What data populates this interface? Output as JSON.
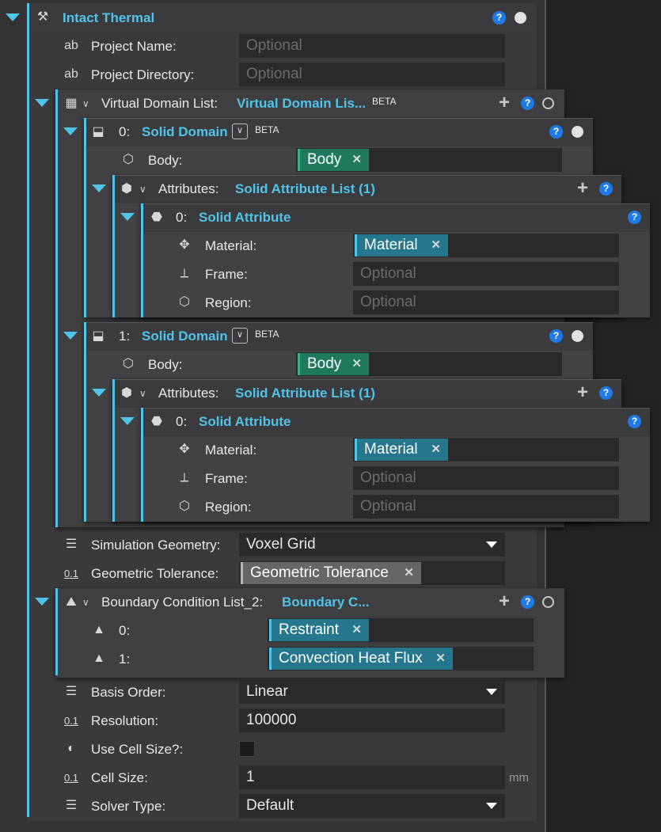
{
  "root": {
    "title": "Intact Thermal"
  },
  "project": {
    "name_label": "Project Name:",
    "name_placeholder": "Optional",
    "dir_label": "Project Directory:",
    "dir_placeholder": "Optional"
  },
  "vdl": {
    "label": "Virtual Domain List:",
    "value": "Virtual Domain Lis...",
    "badge": "BETA",
    "domains": [
      {
        "index": "0:",
        "name": "Solid Domain",
        "badge": "BETA",
        "body_label": "Body:",
        "body_value": "Body",
        "attr_label": "Attributes:",
        "attr_value": "Solid Attribute List (1)",
        "attribute": {
          "index": "0:",
          "name": "Solid Attribute",
          "material_label": "Material:",
          "material_value": "Material",
          "frame_label": "Frame:",
          "frame_placeholder": "Optional",
          "region_label": "Region:",
          "region_placeholder": "Optional"
        }
      },
      {
        "index": "1:",
        "name": "Solid Domain",
        "badge": "BETA",
        "body_label": "Body:",
        "body_value": "Body",
        "attr_label": "Attributes:",
        "attr_value": "Solid Attribute List (1)",
        "attribute": {
          "index": "0:",
          "name": "Solid Attribute",
          "material_label": "Material:",
          "material_value": "Material",
          "frame_label": "Frame:",
          "frame_placeholder": "Optional",
          "region_label": "Region:",
          "region_placeholder": "Optional"
        }
      }
    ]
  },
  "sim_geometry": {
    "label": "Simulation Geometry:",
    "value": "Voxel Grid"
  },
  "geo_tolerance": {
    "label": "Geometric Tolerance:",
    "value": "Geometric Tolerance"
  },
  "bcl": {
    "label": "Boundary Condition List_2:",
    "value": "Boundary C...",
    "items": [
      {
        "index": "0:",
        "value": "Restraint"
      },
      {
        "index": "1:",
        "value": "Convection Heat Flux"
      }
    ]
  },
  "basis_order": {
    "label": "Basis Order:",
    "value": "Linear"
  },
  "resolution": {
    "label": "Resolution:",
    "value": "100000"
  },
  "use_cell_size": {
    "label": "Use Cell Size?:"
  },
  "cell_size": {
    "label": "Cell Size:",
    "value": "1",
    "unit": "mm"
  },
  "solver_type": {
    "label": "Solver Type:",
    "value": "Default"
  },
  "icons": {
    "help": "?",
    "zero_one": "0.1",
    "close": "✕"
  }
}
